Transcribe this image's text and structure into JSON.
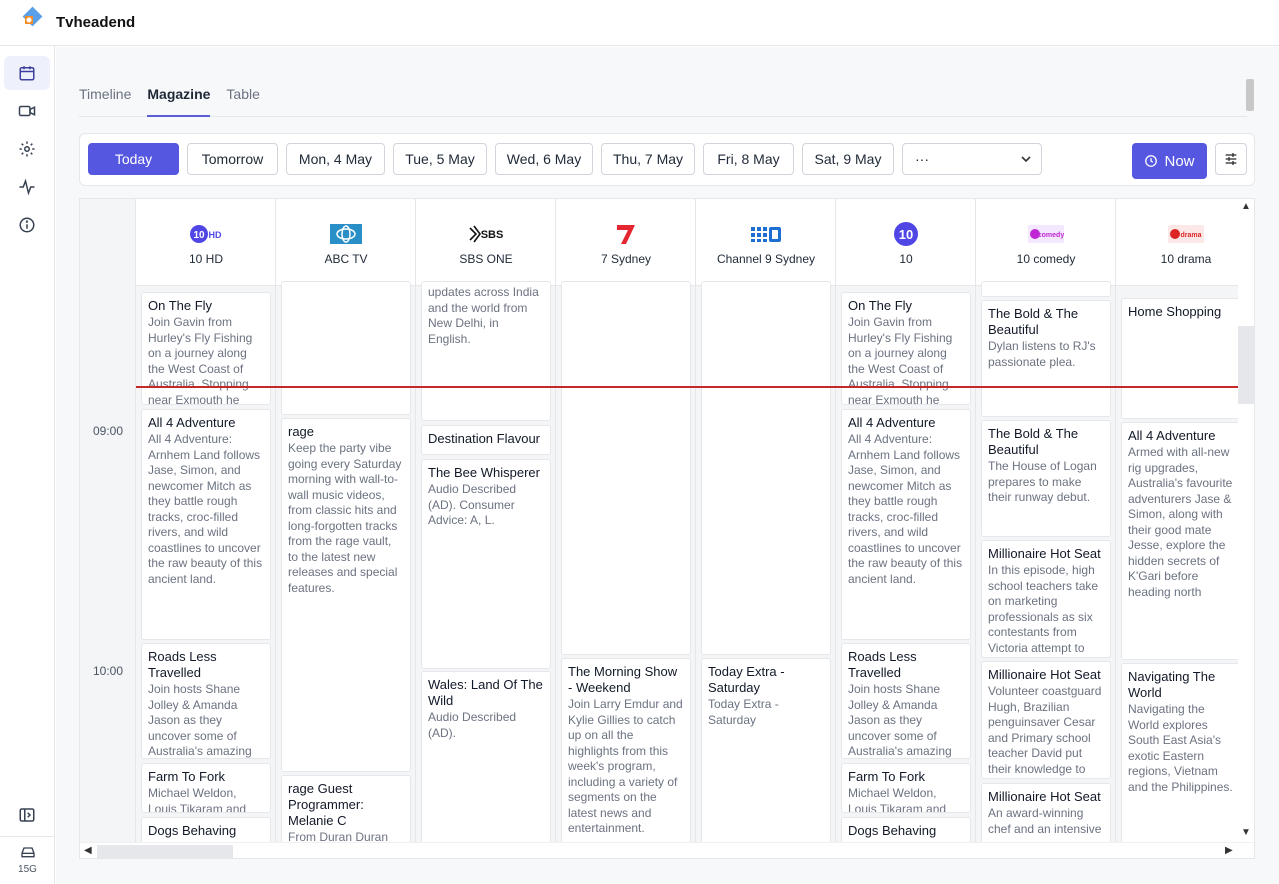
{
  "app": {
    "title": "Tvheadend"
  },
  "sidebar": {
    "disk_label": "15G"
  },
  "tabs": [
    {
      "label": "Timeline"
    },
    {
      "label": "Magazine"
    },
    {
      "label": "Table"
    }
  ],
  "days": {
    "today": "Today",
    "tomorrow": "Tomorrow",
    "d1": "Mon, 4 May",
    "d2": "Tue, 5 May",
    "d3": "Wed, 6 May",
    "d4": "Thu, 7 May",
    "d5": "Fri, 8 May",
    "d6": "Sat, 9 May",
    "more": "···",
    "now": "Now"
  },
  "times": [
    "09:00",
    "10:00"
  ],
  "channels": [
    {
      "name": "10 HD",
      "logo": "10HD"
    },
    {
      "name": "ABC TV",
      "logo": "ABC"
    },
    {
      "name": "SBS ONE",
      "logo": "SBS"
    },
    {
      "name": "7 Sydney",
      "logo": "7"
    },
    {
      "name": "Channel 9 Sydney",
      "logo": "9"
    },
    {
      "name": "10",
      "logo": "10"
    },
    {
      "name": "10 comedy",
      "logo": "10comedy"
    },
    {
      "name": "10 drama",
      "logo": "10drama"
    }
  ],
  "programs": {
    "c0p0": {
      "title": "On The Fly",
      "desc": "Join Gavin from Hurley's Fly Fishing on a journey along the West Coast of Australia. Stopping near Exmouth he"
    },
    "c0p1": {
      "title": "All 4 Adventure",
      "desc": "All 4 Adventure: Arnhem Land follows Jase, Simon, and newcomer Mitch as they battle rough tracks, croc-filled rivers, and wild coastlines to uncover the raw beauty of this ancient land."
    },
    "c0p2": {
      "title": "Roads Less Travelled",
      "desc": "Join hosts Shane Jolley & Amanda Jason as they uncover some of Australia's amazing hidden gems. From the"
    },
    "c0p3": {
      "title": "Farm To Fork",
      "desc": "Michael Weldon, Louis Tikaram and"
    },
    "c0p4": {
      "title": "Dogs Behaving",
      "desc": ""
    },
    "c1p0": {
      "title": "rage",
      "desc": "Keep the party vibe going every Saturday morning with wall-to-wall music videos, from classic hits and long-forgotten tracks from the rage vault, to the latest new releases and special features."
    },
    "c1p1": {
      "title": "rage Guest Programmer: Melanie C",
      "desc": "From Duran Duran"
    },
    "c2p0": {
      "title": "",
      "desc": "updates across India and the world from New Delhi, in English."
    },
    "c2p1": {
      "title": "Destination Flavour",
      "desc": ""
    },
    "c2p2": {
      "title": "The Bee Whisperer",
      "desc": "Audio Described (AD). Consumer Advice: A, L."
    },
    "c2p3": {
      "title": "Wales: Land Of The Wild",
      "desc": "Audio Described (AD)."
    },
    "c3p0": {
      "title": "The Morning Show - Weekend",
      "desc": "Join Larry Emdur and Kylie Gillies to catch up on all the highlights from this week's program, including a variety of segments on the latest news and entertainment."
    },
    "c4p0": {
      "title": "Today Extra - Saturday",
      "desc": "Today Extra - Saturday"
    },
    "c5p0": {
      "title": "On The Fly",
      "desc": "Join Gavin from Hurley's Fly Fishing on a journey along the West Coast of Australia. Stopping near Exmouth he"
    },
    "c5p1": {
      "title": "All 4 Adventure",
      "desc": "All 4 Adventure: Arnhem Land follows Jase, Simon, and newcomer Mitch as they battle rough tracks, croc-filled rivers, and wild coastlines to uncover the raw beauty of this ancient land."
    },
    "c5p2": {
      "title": "Roads Less Travelled",
      "desc": "Join hosts Shane Jolley & Amanda Jason as they uncover some of Australia's amazing hidden gems. From the"
    },
    "c5p3": {
      "title": "Farm To Fork",
      "desc": "Michael Weldon, Louis Tikaram and"
    },
    "c5p4": {
      "title": "Dogs Behaving",
      "desc": ""
    },
    "c6p0": {
      "title": "The Bold & The Beautiful",
      "desc": "Dylan listens to RJ's passionate plea."
    },
    "c6p1": {
      "title": "The Bold & The Beautiful",
      "desc": "The House of Logan prepares to make their runway debut."
    },
    "c6p2": {
      "title": "Millionaire Hot Seat",
      "desc": "In this episode, high school teachers take on marketing professionals as six contestants from Victoria attempt to"
    },
    "c6p3": {
      "title": "Millionaire Hot Seat",
      "desc": "Volunteer coastguard Hugh, Brazilian penguinsaver Cesar and Primary school teacher David put their knowledge to"
    },
    "c6p4": {
      "title": "Millionaire Hot Seat",
      "desc": "An award-winning chef and an intensive"
    },
    "c7p0": {
      "title": "Home Shopping",
      "desc": ""
    },
    "c7p1": {
      "title": "All 4 Adventure",
      "desc": "Armed with all-new rig upgrades, Australia's favourite adventurers Jase & Simon, along with their good mate Jesse, explore the hidden secrets of K'Gari before heading north"
    },
    "c7p2": {
      "title": "Navigating The World",
      "desc": "Navigating the World explores South East Asia's exotic Eastern regions, Vietnam and the Philippines."
    }
  }
}
